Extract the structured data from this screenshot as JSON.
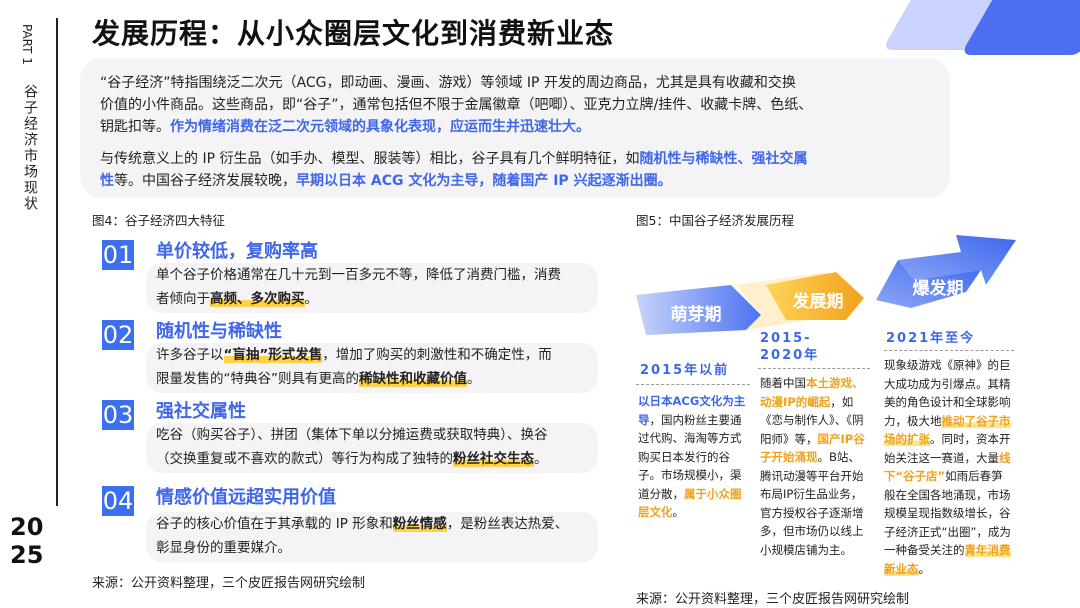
{
  "side": {
    "part": "PART 1",
    "section": "谷子经济市场现状",
    "year_top": "20",
    "year_bottom": "25"
  },
  "title": "发展历程：从小众圈层文化到消费新业态",
  "intro": {
    "p1_a": "“谷子经济”特指围绕泛二次元（ACG，即动画、漫画、游戏）等领域 IP 开发的周边商品，尤其是具有收藏和交换",
    "p1_b": "价值的小件商品。这些商品，即“谷子”，通常包括但不限于金属徽章（吧唧）、亚克力立牌/挂件、收藏卡牌、色纸、",
    "p1_c": "钥匙扣等。",
    "p1_hl": "作为情绪消费在泛二次元领域的具象化表现，应运而生并迅速壮大。",
    "p2_a": "与传统意义上的 IP 衍生品（如手办、模型、服装等）相比，谷子具有几个鲜明特征，如",
    "p2_hl1": "随机性与稀缺性、强社交属",
    "p2_hl1b": "性",
    "p2_b": "等。中国谷子经济发展较晚，",
    "p2_hl2": "早期以日本 ACG 文化为主导，随着国产 IP 兴起逐渐出圈。"
  },
  "fig4": {
    "caption": "图4：谷子经济四大特征",
    "items": [
      {
        "num": "01",
        "head": "单价较低，复购率高",
        "l1": "单个谷子价格通常在几十元到一百多元不等，降低了消费门槛，消费",
        "l2a": "者倾向于",
        "l2hl": "高频、多次购买",
        "l2b": "。"
      },
      {
        "num": "02",
        "head": "随机性与稀缺性",
        "l1a": "许多谷子以",
        "l1hl": "“盲抽”形式发售",
        "l1b": "，增加了购买的刺激性和不确定性，而",
        "l2a": "限量发售的“特典谷”则具有更高的",
        "l2hl": "稀缺性和收藏价值",
        "l2b": "。"
      },
      {
        "num": "03",
        "head": "强社交属性",
        "l1": "吃谷（购买谷子）、拼团（集体下单以分摊运费或获取特典）、换谷",
        "l2a": "（交换重复或不喜欢的款式）等行为构成了独特的",
        "l2hl": "粉丝社交生态",
        "l2b": "。"
      },
      {
        "num": "04",
        "head": "情感价值远超实用价值",
        "l1a": "谷子的核心价值在于其承载的 IP 形象和",
        "l1hl": "粉丝情感",
        "l1b": "，是粉丝表达热爱、",
        "l2": "彰显身份的重要媒介。"
      }
    ],
    "source": "来源：公开资料整理，三个皮匠报告网研究绘制"
  },
  "fig5": {
    "caption": "图5：中国谷子经济发展历程",
    "stages": [
      "萌芽期",
      "发展期",
      "爆发期"
    ],
    "col1": {
      "era": "2015年以前",
      "hl1": "以日本ACG文化为主导",
      "t1": "，国内粉丝主要通过代购、海淘等方式购买日本发行的谷子。市场规模小，渠道分散，",
      "hl2": "属于小众圈层文化",
      "t2": "。"
    },
    "col2": {
      "era_a": "2015-",
      "era_b": "2020年",
      "t0": "随着中国",
      "hl1": "本土游戏、动漫IP的崛起",
      "t1": "，如《恋与制作人》、《阴阳师》等，",
      "hl2": "国产IP谷子开始涌现",
      "t2": "。B站、腾讯动漫等平台开始布局IP衍生品业务，官方授权谷子逐渐增多，但市场仍以线上小规模店铺为主。"
    },
    "col3": {
      "era": "2021年至今",
      "t0": "现象级游戏《原神》的巨大成功成为引爆点。其精美的角色设计和全球影响力，极大地",
      "hl1": "推动了谷子市场的扩张",
      "t1": "。同时，资本开始关注这一赛道，大量",
      "hl2": "线下“谷子店”",
      "t2": "如雨后春笋般在全国各地涌现，市场规模呈现指数级增长，谷子经济正式“出圈”，成为一种备受关注的",
      "hl3": "青年消费新业态",
      "t3": "。"
    },
    "source": "来源：公开资料整理，三个皮匠报告网研究绘制"
  }
}
